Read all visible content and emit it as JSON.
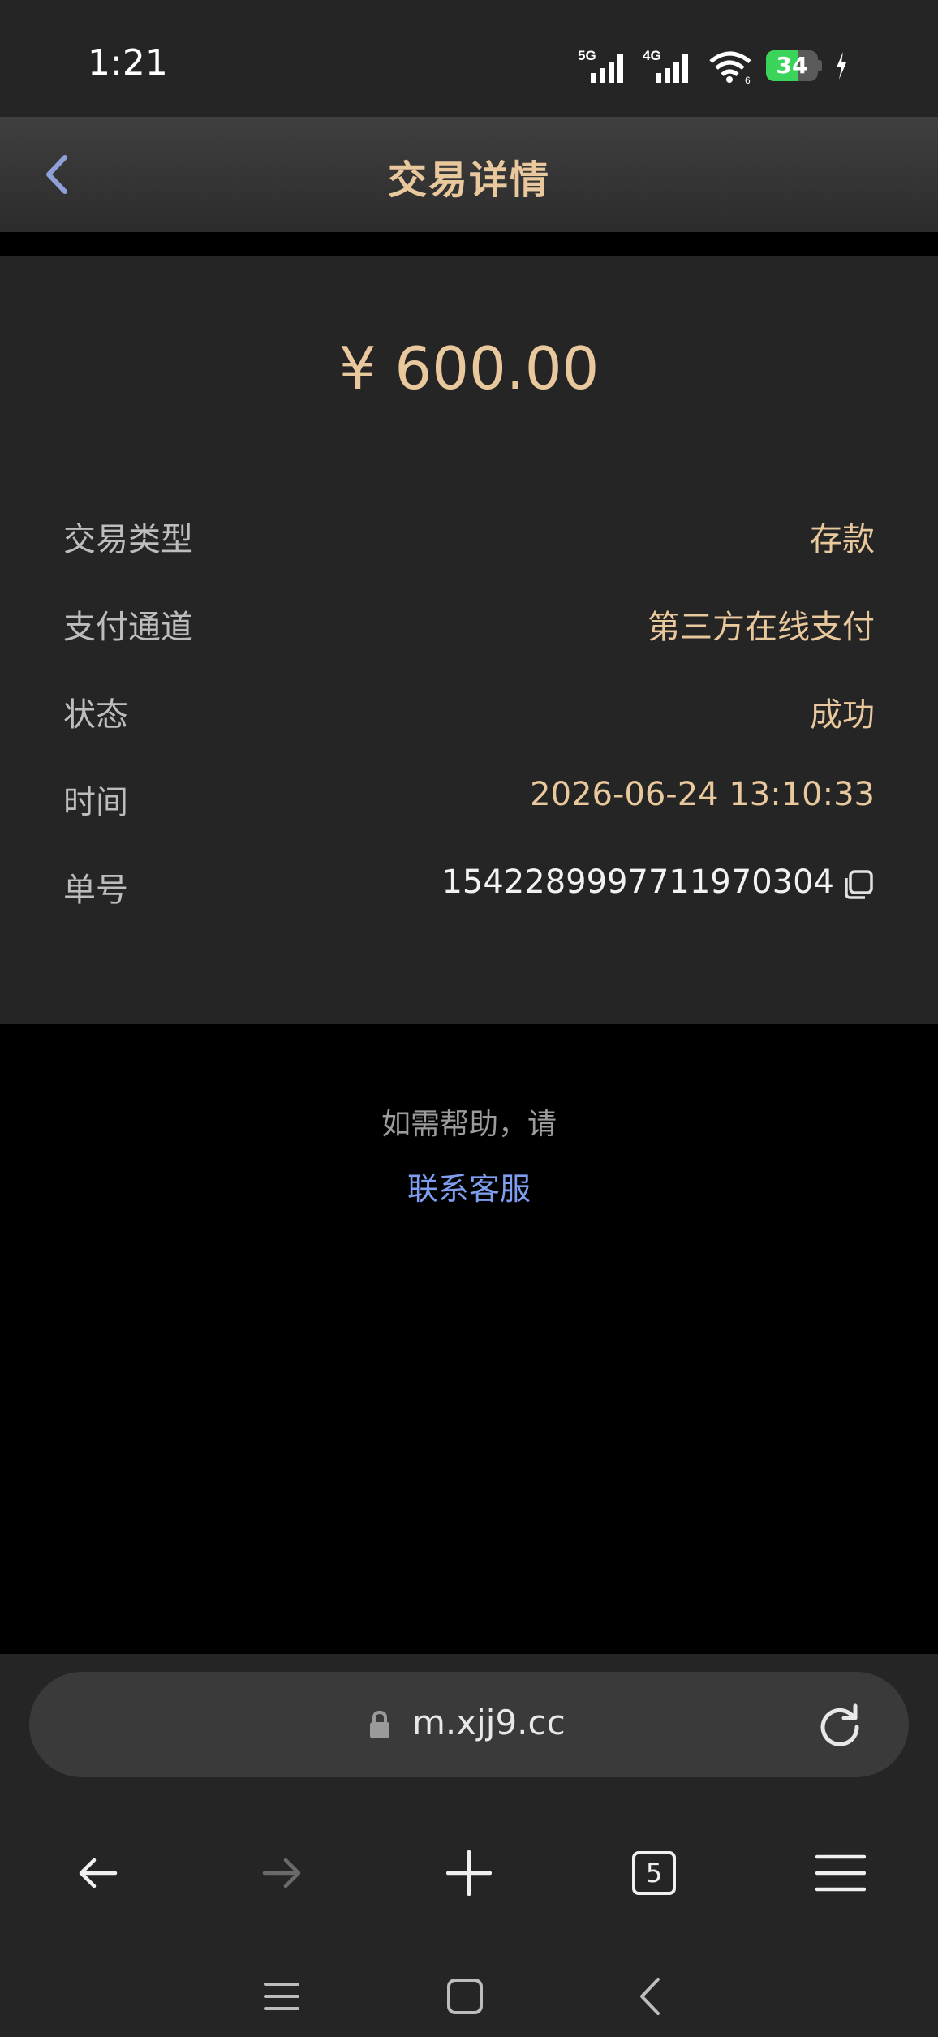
{
  "status_bar": {
    "time": "1:21",
    "sim1": "5G",
    "sim2": "4G",
    "battery": "34"
  },
  "header": {
    "title": "交易详情",
    "back_icon": "chevron-left-icon"
  },
  "transaction": {
    "amount": "¥ 600.00",
    "rows": [
      {
        "label": "交易类型",
        "value": "存款"
      },
      {
        "label": "支付通道",
        "value": "第三方在线支付"
      },
      {
        "label": "状态",
        "value": "成功"
      },
      {
        "label": "时间",
        "value": "2026-06-24 13:10:33"
      },
      {
        "label": "单号",
        "value": "1542289997711970304"
      }
    ]
  },
  "help": {
    "text": "如需帮助，请",
    "link": "联系客服"
  },
  "browser": {
    "url": "m.xjj9.cc",
    "tab_count": "5"
  },
  "colors": {
    "accent_gold": "#e8c89c",
    "link_blue": "#7f9ef0",
    "battery_green": "#3bd45a"
  }
}
